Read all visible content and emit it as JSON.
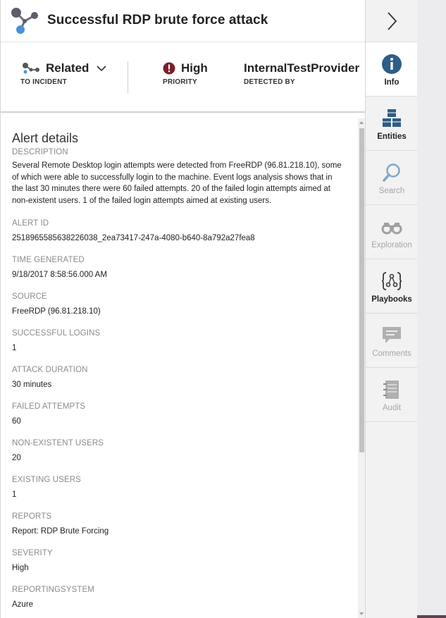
{
  "header": {
    "title": "Successful RDP brute force attack",
    "logo_icon": "alert-graph-icon"
  },
  "summary": {
    "related": {
      "value": "Related",
      "label": "TO INCIDENT",
      "icon": "graph-nodes-icon"
    },
    "priority": {
      "value": "High",
      "label": "PRIORITY",
      "icon": "exclamation-circle-icon",
      "color": "#7a1f2b"
    },
    "detected_by": {
      "value": "InternalTestProvider",
      "label": "DETECTED BY"
    }
  },
  "details": {
    "title": "Alert details",
    "fields": [
      {
        "label": "DESCRIPTION",
        "value": "Several Remote Desktop login attempts were detected from FreeRDP (96.81.218.10), some of which were able to successfully login to the machine. Event logs analysis shows that in the last 30 minutes there were 60 failed attempts. 20 of the failed login attempts aimed at non-existent users. 1 of the failed login attempts aimed at existing users."
      },
      {
        "label": "ALERT ID",
        "value": "2518965585638226038_2ea73417-247a-4080-b640-8a792a27fea8"
      },
      {
        "label": "TIME GENERATED",
        "value": "9/18/2017 8:58:56.000 AM"
      },
      {
        "label": "SOURCE",
        "value": "FreeRDP (96.81.218.10)"
      },
      {
        "label": "SUCCESSFUL LOGINS",
        "value": "1"
      },
      {
        "label": "ATTACK DURATION",
        "value": "30 minutes"
      },
      {
        "label": "FAILED ATTEMPTS",
        "value": "60"
      },
      {
        "label": "NON-EXISTENT USERS",
        "value": "20"
      },
      {
        "label": "EXISTING USERS",
        "value": "1"
      },
      {
        "label": "REPORTS",
        "value": "Report: RDP Brute Forcing"
      },
      {
        "label": "SEVERITY",
        "value": "High"
      },
      {
        "label": "REPORTINGSYSTEM",
        "value": "Azure"
      }
    ]
  },
  "rail": {
    "collapse_icon": "chevron-right-icon",
    "tabs": [
      {
        "label": "Info",
        "icon": "info-icon",
        "active": true
      },
      {
        "label": "Entities",
        "icon": "cubes-icon",
        "active": false
      },
      {
        "label": "Search",
        "icon": "search-icon",
        "active": false
      },
      {
        "label": "Exploration",
        "icon": "binoculars-icon",
        "active": false
      },
      {
        "label": "Playbooks",
        "icon": "playbook-icon",
        "active": false
      },
      {
        "label": "Comments",
        "icon": "comment-icon",
        "active": false
      },
      {
        "label": "Audit",
        "icon": "notebook-icon",
        "active": false
      }
    ]
  },
  "colors": {
    "accent_dark": "#5c4351",
    "icon_blue": "#2f5d87",
    "muted": "#a6a6a6"
  }
}
